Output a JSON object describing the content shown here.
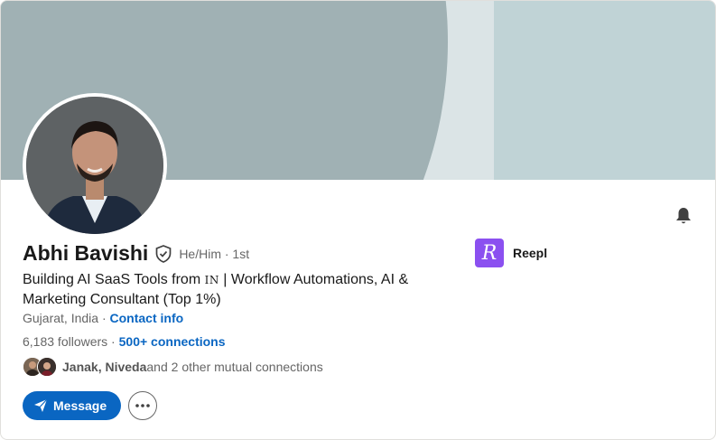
{
  "profile": {
    "name": "Abhi Bavishi",
    "pronouns": "He/Him",
    "degree": "· 1st",
    "headline_part1": "Building AI SaaS Tools from ",
    "headline_in": "IN",
    "headline_part2": " | Workflow Automations, AI & Marketing Consultant (Top 1%)",
    "location": "Gujarat, India",
    "location_sep": " · ",
    "contact_info": "Contact info",
    "followers": "6,183 followers",
    "followers_sep": " · ",
    "connections": "500+ connections",
    "mutual_names": "Janak, Niveda",
    "mutual_rest": " and 2 other mutual connections"
  },
  "company": {
    "logo_letter": "R",
    "name": "Reepl"
  },
  "actions": {
    "message_label": "Message"
  },
  "icons": [
    "verified-shield-icon",
    "bell-icon",
    "send-icon",
    "more-icon"
  ],
  "colors": {
    "banner_light": "#c0d3d6",
    "banner_mid": "#dbe4e6",
    "banner_arc": "#a0b1b4",
    "link": "#0a66c2",
    "company_logo": "#8b50f0"
  }
}
